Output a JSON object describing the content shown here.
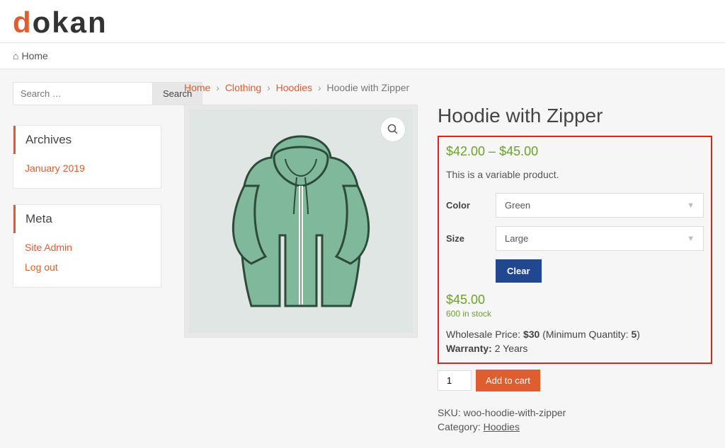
{
  "logo": {
    "d": "d",
    "rest": "okan"
  },
  "nav": {
    "home": "Home"
  },
  "search": {
    "placeholder": "Search …",
    "button": "Search"
  },
  "widgets": {
    "archives": {
      "title": "Archives",
      "items": [
        "January 2019"
      ]
    },
    "meta": {
      "title": "Meta",
      "items": [
        "Site Admin",
        "Log out"
      ]
    }
  },
  "breadcrumb": {
    "home": "Home",
    "clothing": "Clothing",
    "hoodies": "Hoodies",
    "current": "Hoodie with Zipper"
  },
  "product": {
    "title": "Hoodie with Zipper",
    "price_range": "$42.00 – $45.00",
    "short_desc": "This is a variable product.",
    "variations": {
      "color": {
        "label": "Color",
        "selected": "Green"
      },
      "size": {
        "label": "Size",
        "selected": "Large"
      }
    },
    "clear": "Clear",
    "single_price": "$45.00",
    "stock": "600 in stock",
    "wholesale": {
      "label": "Wholesale Price:",
      "price": "$30",
      "min_label": "(Minimum Quantity:",
      "min": "5",
      "close": ")"
    },
    "warranty": {
      "label": "Warranty:",
      "value": "2 Years"
    },
    "qty": "1",
    "add_to_cart": "Add to cart",
    "sku": {
      "label": "SKU:",
      "value": "woo-hoodie-with-zipper"
    },
    "category": {
      "label": "Category:",
      "value": "Hoodies"
    }
  }
}
